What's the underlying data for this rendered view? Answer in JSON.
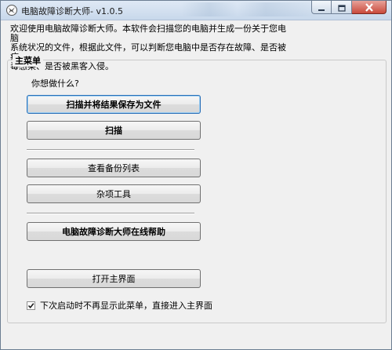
{
  "window": {
    "title": "电脑故障诊断大师- v1.0.5",
    "icons": {
      "app": "app-logo-icon",
      "minimize": "minimize-icon",
      "maximize": "maximize-icon",
      "close": "close-icon"
    }
  },
  "intro": {
    "line1": "欢迎使用电脑故障诊断大师。本软件会扫描您的电脑并生成一份关于您电脑",
    "line2": "系统状况的文件，根据此文件，可以判断您电脑中是否存在故障、是否被病",
    "line3": "毒感染、是否被黑客入侵。"
  },
  "main_menu": {
    "legend": "主菜单",
    "question": "你想做什么?",
    "buttons": {
      "scan_save": "扫描并将结果保存为文件",
      "scan": "扫描",
      "view_backups": "查看备份列表",
      "misc_tools": "杂项工具",
      "online_help": "电脑故障诊断大师在线帮助",
      "open_main": "打开主界面"
    },
    "checkbox": {
      "label": "下次启动时不再显示此菜单，直接进入主界面",
      "checked": true
    }
  },
  "colors": {
    "titlebar": "#c8d8eb",
    "window_bg": "#f0f0f0",
    "close_button": "#c94a3b",
    "button_border": "#707070"
  }
}
